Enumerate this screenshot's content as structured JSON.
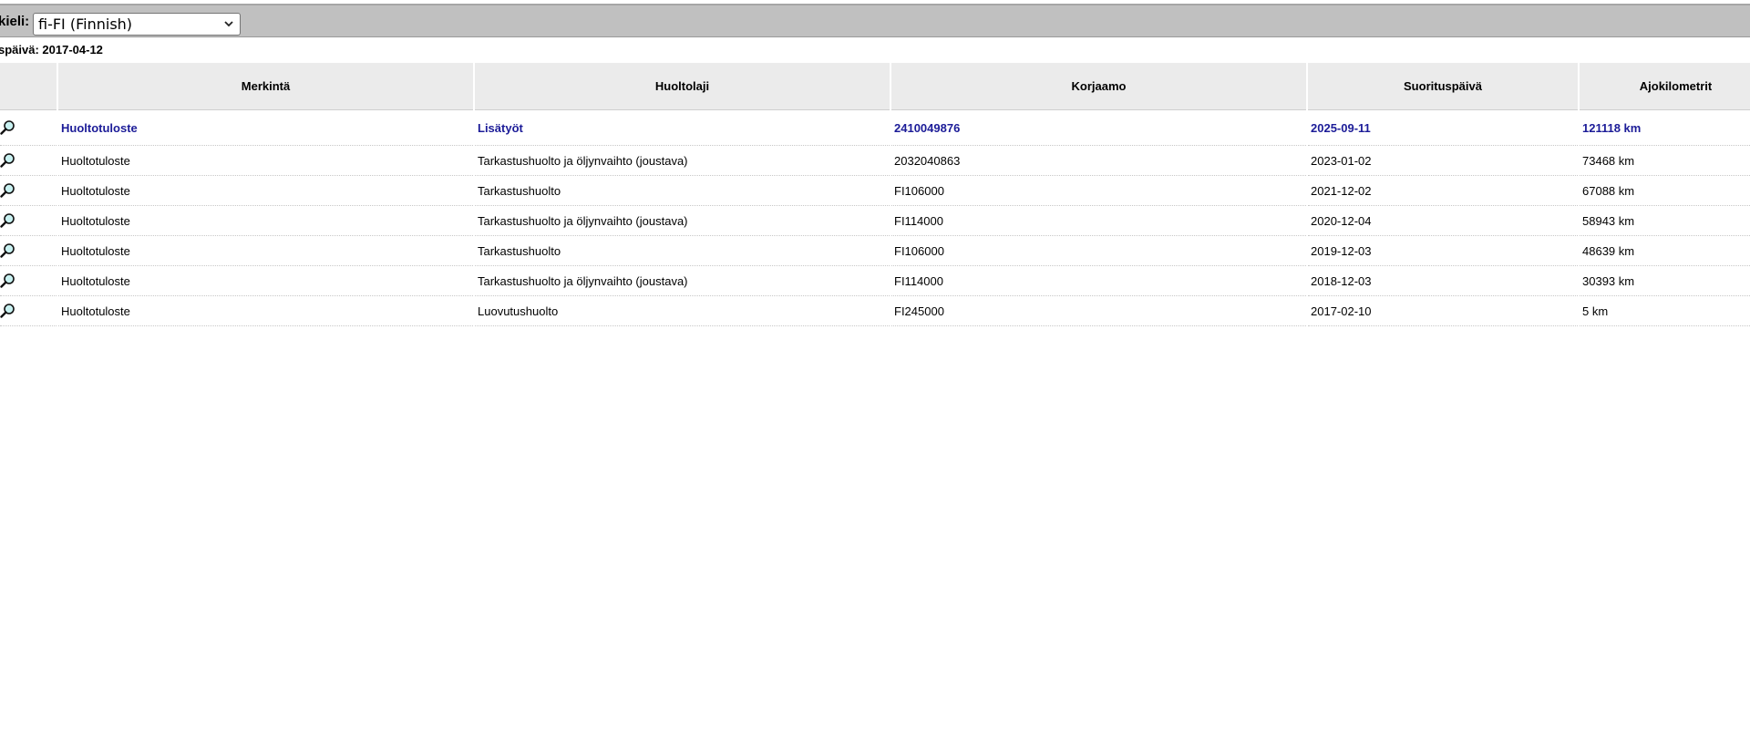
{
  "language": {
    "label": "kieli:",
    "selected": "fi-FI (Finnish)"
  },
  "date_line": "späivä: 2017-04-12",
  "table": {
    "columns": [
      "Merkintä",
      "Huoltolaji",
      "Korjaamo",
      "Suorituspäivä",
      "Ajokilometrit"
    ],
    "rows": [
      {
        "merkinta": "Huoltotuloste",
        "huoltolaji": "Lisätyöt",
        "korjaamo": "2410049876",
        "paiva": "2025-09-11",
        "km": "121118 km"
      },
      {
        "merkinta": "Huoltotuloste",
        "huoltolaji": "Tarkastushuolto ja öljynvaihto (joustava)",
        "korjaamo": "2032040863",
        "paiva": "2023-01-02",
        "km": "73468 km"
      },
      {
        "merkinta": "Huoltotuloste",
        "huoltolaji": "Tarkastushuolto",
        "korjaamo": "FI106000",
        "paiva": "2021-12-02",
        "km": "67088 km"
      },
      {
        "merkinta": "Huoltotuloste",
        "huoltolaji": "Tarkastushuolto ja öljynvaihto (joustava)",
        "korjaamo": "FI114000",
        "paiva": "2020-12-04",
        "km": "58943 km"
      },
      {
        "merkinta": "Huoltotuloste",
        "huoltolaji": "Tarkastushuolto",
        "korjaamo": "FI106000",
        "paiva": "2019-12-03",
        "km": "48639 km"
      },
      {
        "merkinta": "Huoltotuloste",
        "huoltolaji": "Tarkastushuolto ja öljynvaihto (joustava)",
        "korjaamo": "FI114000",
        "paiva": "2018-12-03",
        "km": "30393 km"
      },
      {
        "merkinta": "Huoltotuloste",
        "huoltolaji": "Luovutushuolto",
        "korjaamo": "FI245000",
        "paiva": "2017-02-10",
        "km": "5 km"
      }
    ]
  },
  "icons": {
    "row_view": "magnifier-icon",
    "select": "chevron-down-icon"
  },
  "colors": {
    "highlight_text": "#1c1c98",
    "toolbar_bg": "#c0c0c0",
    "header_bg": "#ebebeb"
  }
}
